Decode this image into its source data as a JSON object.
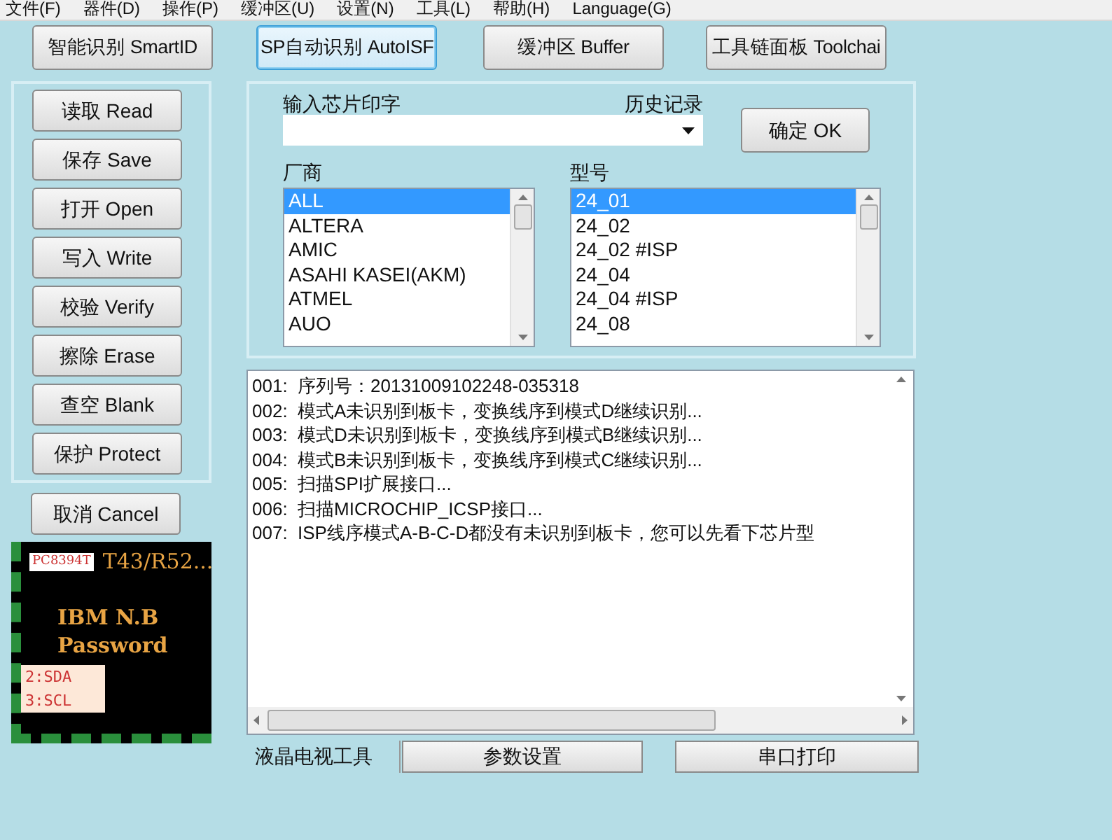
{
  "menu": [
    "文件(F)",
    "器件(D)",
    "操作(P)",
    "缓冲区(U)",
    "设置(N)",
    "工具(L)",
    "帮助(H)",
    "Language(G)"
  ],
  "toolbar": [
    {
      "label": "智能识别 SmartID",
      "focused": false
    },
    {
      "label": "SP自动识别 AutoISF",
      "focused": true
    },
    {
      "label": "缓冲区 Buffer",
      "focused": false
    },
    {
      "label": "工具链面板 Toolchai",
      "focused": false
    }
  ],
  "actions": [
    "读取 Read",
    "保存 Save",
    "打开 Open",
    "写入 Write",
    "校验 Verify",
    "擦除 Erase",
    "查空 Blank",
    "保护 Protect"
  ],
  "cancel_button": "取消 Cancel",
  "chip_card": {
    "marking": "PC8394T",
    "model": "T43/R52...",
    "title_lines": [
      "IBM N.B",
      "Password"
    ],
    "pins": [
      "2:SDA",
      "3:SCL"
    ]
  },
  "chip_input": {
    "label": "输入芯片印字",
    "history_label": "历史记录"
  },
  "ok_button": "确定 OK",
  "vendor_list": {
    "label": "厂商",
    "items": [
      {
        "label": "ALL",
        "selected": true
      },
      {
        "label": "ALTERA",
        "selected": false
      },
      {
        "label": "AMIC",
        "selected": false
      },
      {
        "label": "ASAHI KASEI(AKM)",
        "selected": false
      },
      {
        "label": "ATMEL",
        "selected": false
      },
      {
        "label": "AUO",
        "selected": false
      }
    ]
  },
  "model_list": {
    "label": "型号",
    "items": [
      {
        "label": "24_01",
        "selected": true
      },
      {
        "label": "24_02",
        "selected": false
      },
      {
        "label": "24_02 #ISP",
        "selected": false
      },
      {
        "label": "24_04",
        "selected": false
      },
      {
        "label": "24_04 #ISP",
        "selected": false
      },
      {
        "label": "24_08",
        "selected": false
      }
    ]
  },
  "log": [
    "001:  序列号：20131009102248-035318",
    "002:  模式A未识别到板卡，变换线序到模式D继续识别...",
    "003:  模式D未识别到板卡，变换线序到模式B继续识别...",
    "004:  模式B未识别到板卡，变换线序到模式C继续识别...",
    "005:  扫描SPI扩展接口...",
    "006:  扫描MICROCHIP_ICSP接口...",
    "007:  ISP线序模式A-B-C-D都没有未识别到板卡，您可以先看下芯片型"
  ],
  "bottom_bar": [
    {
      "label": "液晶电视工具",
      "kind": "label"
    },
    {
      "label": "参数设置",
      "kind": "button"
    },
    {
      "label": "串口打印",
      "kind": "button"
    }
  ]
}
